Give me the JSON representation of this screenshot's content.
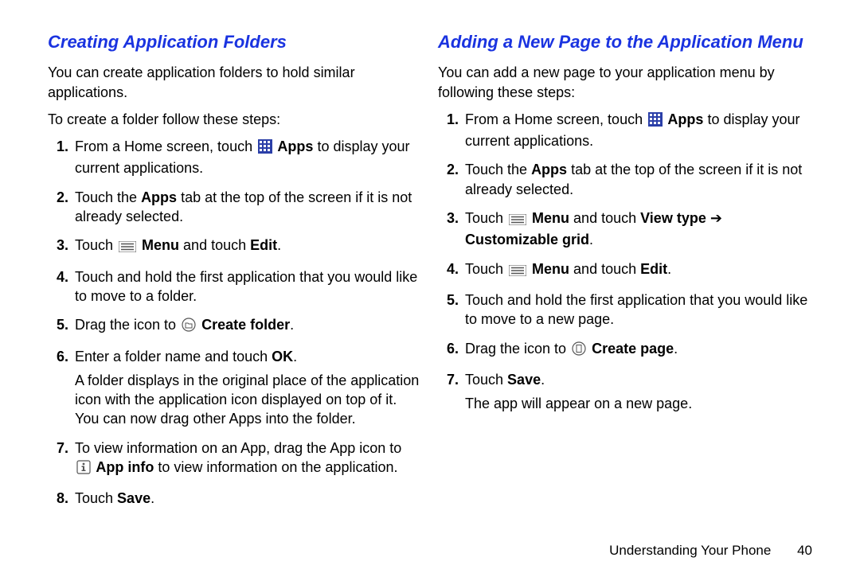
{
  "left": {
    "heading": "Creating Application Folders",
    "intro1": "You can create application folders to hold similar applications.",
    "intro2": "To create a folder follow these steps:",
    "s1a": "From a Home screen, touch ",
    "s1b": " Apps",
    "s1c": " to display your current applications.",
    "s2a": "Touch the ",
    "s2b": "Apps",
    "s2c": " tab at the top of the screen if it is not already selected.",
    "s3a": "Touch ",
    "s3b": " Menu",
    "s3c": " and touch ",
    "s3d": "Edit",
    "s3e": ".",
    "s4": "Touch and hold the first application that you would like to move to a folder.",
    "s5a": "Drag the icon to ",
    "s5b": " Create folder",
    "s5c": ".",
    "s6a": "Enter a folder name and touch ",
    "s6b": "OK",
    "s6c": ".",
    "s6note": "A folder displays in the original place of the application icon with the application icon displayed on top of it. You can now drag other Apps into the folder.",
    "s7a": "To view information on an App, drag the App icon to ",
    "s7b": " App info",
    "s7c": " to view information on the application.",
    "s8a": "Touch ",
    "s8b": "Save",
    "s8c": "."
  },
  "right": {
    "heading": "Adding a New Page to the Application Menu",
    "intro1": "You can add a new page to your application menu by following these steps:",
    "s1a": "From a Home screen, touch ",
    "s1b": " Apps",
    "s1c": " to display your current applications.",
    "s2a": "Touch the ",
    "s2b": "Apps",
    "s2c": " tab at the top of the screen if it is not already selected.",
    "s3a": "Touch ",
    "s3b": " Menu",
    "s3c": " and touch ",
    "s3d": "View type",
    "s3e": " ➔ ",
    "s3f": "Customizable grid",
    "s3g": ".",
    "s4a": "Touch ",
    "s4b": " Menu",
    "s4c": " and touch ",
    "s4d": "Edit",
    "s4e": ".",
    "s5": "Touch and hold the first application that you would like to move to a new page.",
    "s6a": "Drag the icon to ",
    "s6b": " Create page",
    "s6c": ".",
    "s7a": "Touch ",
    "s7b": "Save",
    "s7c": ".",
    "s7note": "The app will appear on a new page."
  },
  "footer": {
    "section": "Understanding Your Phone",
    "page": "40"
  }
}
